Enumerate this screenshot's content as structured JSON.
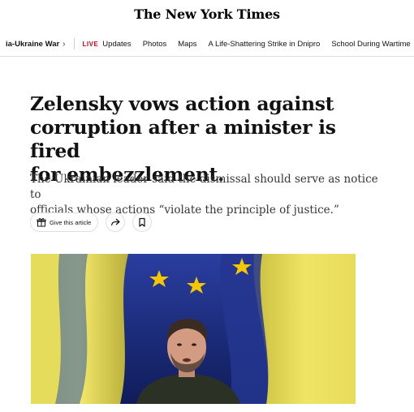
{
  "masthead": {
    "logo_text": "The New York Times"
  },
  "nav": {
    "section": "ia-Ukraine War",
    "live_badge": "LIVE",
    "items": [
      "Updates",
      "Photos",
      "Maps",
      "A Life-Shattering Strike in Dnipro",
      "School During Wartime"
    ]
  },
  "article": {
    "headline_lines": [
      "Zelensky vows action against",
      "corruption after a minister is fired",
      "for embezzlement."
    ],
    "summary_lines": [
      "The Ukrainian leader said the dismissal should serve as notice to",
      "officials whose actions “violate the principle of justice.”"
    ]
  },
  "actions": {
    "gift_label": "Give this article",
    "gift_icon": "gift-icon",
    "share_icon": "share-icon",
    "bookmark_icon": "bookmark-icon"
  },
  "colors": {
    "live_red": "#d0021b",
    "flag_yellow": "#f4e34a",
    "eu_blue": "#1e2f8a",
    "star_gold": "#f6c700"
  }
}
